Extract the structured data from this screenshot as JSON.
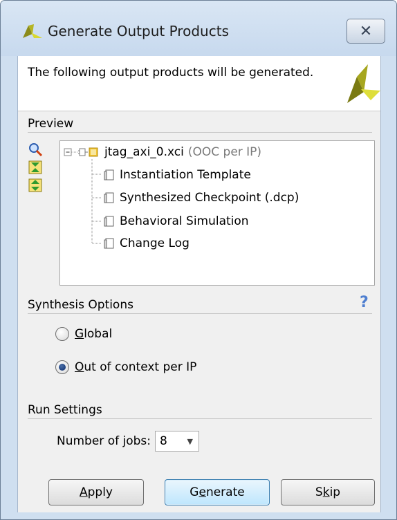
{
  "window": {
    "title": "Generate Output Products",
    "close_glyph": "✕"
  },
  "header": {
    "message": "The following output products will be generated."
  },
  "preview": {
    "section_title": "Preview",
    "toolbar_icons": [
      "search-icon",
      "collapse-all-icon",
      "expand-all-icon"
    ],
    "tree": {
      "root_name": "jtag_axi_0.xci",
      "root_suffix": "(OOC per IP)",
      "children": [
        "Instantiation Template",
        "Synthesized Checkpoint (.dcp)",
        "Behavioral Simulation",
        "Change Log"
      ]
    }
  },
  "synthesis": {
    "section_title": "Synthesis Options",
    "help_glyph": "?",
    "options": [
      {
        "mnemonic": "G",
        "rest": "lobal",
        "selected": false
      },
      {
        "mnemonic": "O",
        "rest": "ut of context per IP",
        "selected": true
      }
    ]
  },
  "run_settings": {
    "section_title": "Run Settings",
    "jobs_label_pre": "Number of ",
    "jobs_label_mnemonic": "j",
    "jobs_label_post": "obs:",
    "jobs_value": "8"
  },
  "buttons": {
    "apply_mnemonic": "A",
    "apply_rest": "pply",
    "generate_pre": "G",
    "generate_mnemonic": "e",
    "generate_post": "nerate",
    "skip_pre": "S",
    "skip_mnemonic": "k",
    "skip_post": "ip"
  },
  "colors": {
    "title_bar": "#cfdff0",
    "dialog_bg": "#f0f0f0",
    "logo_olive": "#8b8b1a",
    "logo_yellow": "#d8d830",
    "default_button_border": "#3c7fb1"
  }
}
